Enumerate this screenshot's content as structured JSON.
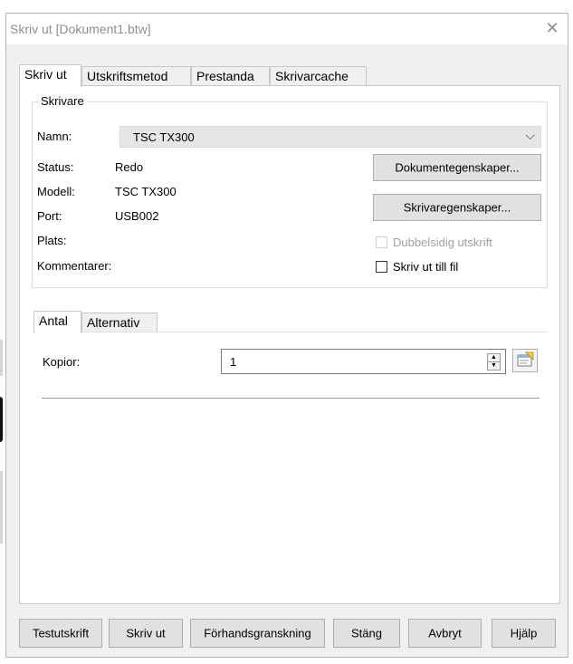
{
  "window": {
    "title": "Skriv ut [Dokument1.btw]",
    "close_glyph": "✕"
  },
  "tabs": [
    "Skriv ut",
    "Utskriftsmetod",
    "Prestanda",
    "Skrivarcache"
  ],
  "printer_group": {
    "legend": "Skrivare",
    "name_label": "Namn:",
    "name_value": "TSC TX300",
    "dropdown_glyph": "⌵",
    "status_label": "Status:",
    "status_value": "Redo",
    "model_label": "Modell:",
    "model_value": "TSC TX300",
    "port_label": "Port:",
    "port_value": "USB002",
    "location_label": "Plats:",
    "comment_label": "Kommentarer:",
    "document_properties_button": "Dokumentegenskaper...",
    "printer_properties_button": "Skrivaregenskaper...",
    "duplex_label": "Dubbelsidig utskrift",
    "print_to_file_label": "Skriv ut till fil"
  },
  "subtabs": [
    "Antal",
    "Alternativ"
  ],
  "copies": {
    "label": "Kopior:",
    "value": "1"
  },
  "buttons": {
    "test_print": "Testutskrift",
    "print": "Skriv ut",
    "preview": "Förhandsgranskning",
    "close": "Stäng",
    "cancel": "Avbryt",
    "help": "Hjälp"
  },
  "icons": {
    "close": "close-icon",
    "dropdown": "chevron-down-icon",
    "spin_up": "arrow-up-icon",
    "spin_down": "arrow-down-icon",
    "picker": "variable-picker-icon"
  }
}
